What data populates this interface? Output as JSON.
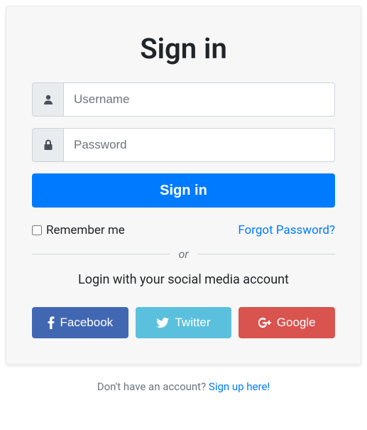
{
  "title": "Sign in",
  "inputs": {
    "username_placeholder": "Username",
    "password_placeholder": "Password"
  },
  "buttons": {
    "signin": "Sign in"
  },
  "remember": {
    "label": "Remember me"
  },
  "forgot": "Forgot Password?",
  "divider": "or",
  "social_prompt": "Login with your social media account",
  "social": {
    "facebook": "Facebook",
    "twitter": "Twitter",
    "google": "Google"
  },
  "footer": {
    "text": "Don't have an account? ",
    "link": "Sign up here!"
  }
}
